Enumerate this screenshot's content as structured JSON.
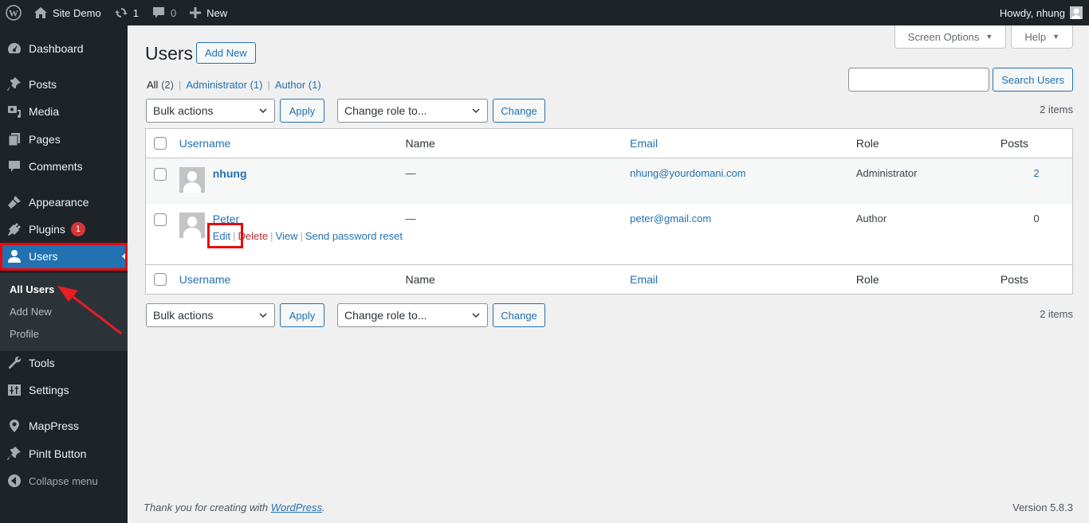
{
  "adminbar": {
    "site_name": "Site Demo",
    "updates_count": "1",
    "comments_count": "0",
    "new_label": "New",
    "howdy": "Howdy, nhung"
  },
  "sidebar": {
    "items": [
      {
        "label": "Dashboard",
        "icon": "dashboard-icon"
      },
      {
        "label": "Posts",
        "icon": "pushpin-icon"
      },
      {
        "label": "Media",
        "icon": "media-icon"
      },
      {
        "label": "Pages",
        "icon": "pages-icon"
      },
      {
        "label": "Comments",
        "icon": "comment-icon"
      },
      {
        "label": "Appearance",
        "icon": "brush-icon"
      },
      {
        "label": "Plugins",
        "icon": "plugin-icon",
        "badge": "1"
      },
      {
        "label": "Users",
        "icon": "user-icon",
        "current": true
      },
      {
        "label": "Tools",
        "icon": "wrench-icon"
      },
      {
        "label": "Settings",
        "icon": "settings-icon"
      },
      {
        "label": "MapPress",
        "icon": "location-pin-icon"
      },
      {
        "label": "PinIt Button",
        "icon": "pushpin-icon"
      },
      {
        "label": "Collapse menu",
        "icon": "collapse-icon"
      }
    ],
    "submenu": [
      {
        "label": "All Users",
        "current": true
      },
      {
        "label": "Add New"
      },
      {
        "label": "Profile"
      }
    ]
  },
  "screen_tabs": {
    "screen_options": "Screen Options",
    "help": "Help"
  },
  "page": {
    "title": "Users",
    "add_new": "Add New",
    "filters": [
      {
        "label": "All",
        "count": "(2)",
        "current": true
      },
      {
        "label": "Administrator",
        "count": "(1)"
      },
      {
        "label": "Author",
        "count": "(1)"
      }
    ],
    "search_value": "",
    "search_button": "Search Users",
    "bulk_actions": "Bulk actions",
    "apply": "Apply",
    "change_role": "Change role to...",
    "change": "Change",
    "items_count": "2 items"
  },
  "table": {
    "columns": [
      "Username",
      "Name",
      "Email",
      "Role",
      "Posts"
    ],
    "rows": [
      {
        "username": "nhung",
        "name": "—",
        "email": "nhung@yourdomani.com",
        "role": "Administrator",
        "posts": "2"
      },
      {
        "username": "Peter",
        "name": "—",
        "email": "peter@gmail.com",
        "role": "Author",
        "posts": "0",
        "actions": [
          "Edit",
          "Delete",
          "View",
          "Send password reset"
        ]
      }
    ]
  },
  "footer": {
    "thanks_prefix": "Thank you for creating with ",
    "thanks_link": "WordPress",
    "thanks_suffix": ".",
    "version": "Version 5.8.3"
  }
}
